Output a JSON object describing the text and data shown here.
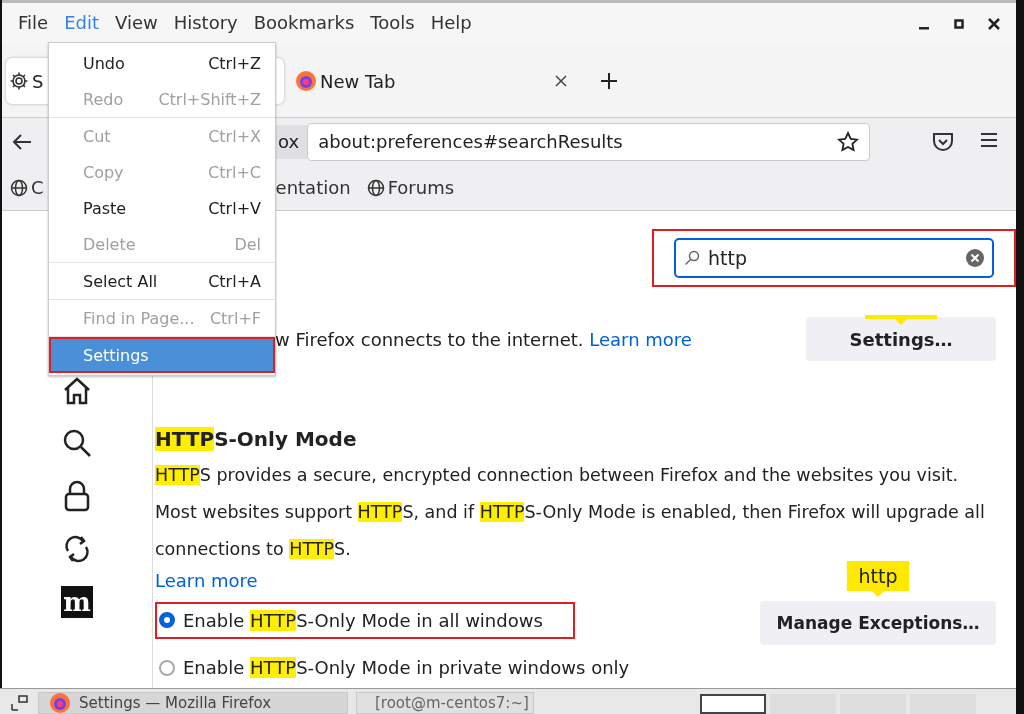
{
  "menu_bar": {
    "items": [
      {
        "label": "File",
        "selected": false
      },
      {
        "label": "Edit",
        "selected": true
      },
      {
        "label": "View",
        "selected": false
      },
      {
        "label": "History",
        "selected": false
      },
      {
        "label": "Bookmarks",
        "selected": false
      },
      {
        "label": "Tools",
        "selected": false
      },
      {
        "label": "Help",
        "selected": false
      }
    ],
    "window_controls": [
      {
        "kind": "minimize"
      },
      {
        "kind": "maximize"
      },
      {
        "kind": "close"
      }
    ]
  },
  "tabs": [
    {
      "kind": "settings",
      "label": "S",
      "selected": true
    },
    {
      "kind": "firefox",
      "label": "New Tab",
      "selected": false
    }
  ],
  "nav": {
    "identity": "ox",
    "url": "about:preferences#searchResults"
  },
  "bookmarks": [
    {
      "label": "C",
      "icon": true
    },
    {
      "label": "entation",
      "icon": false
    },
    {
      "label": "Forums",
      "icon": true
    }
  ],
  "edit_menu": {
    "items": [
      {
        "kind": "item",
        "label": "Undo",
        "shortcut": "Ctrl+Z",
        "disabled": false,
        "selected": false,
        "outlined": false
      },
      {
        "kind": "item",
        "label": "Redo",
        "shortcut": "Ctrl+Shift+Z",
        "disabled": true,
        "selected": false,
        "outlined": false
      },
      {
        "kind": "separator"
      },
      {
        "kind": "item",
        "label": "Cut",
        "shortcut": "Ctrl+X",
        "disabled": true,
        "selected": false,
        "outlined": false
      },
      {
        "kind": "item",
        "label": "Copy",
        "shortcut": "Ctrl+C",
        "disabled": true,
        "selected": false,
        "outlined": false
      },
      {
        "kind": "item",
        "label": "Paste",
        "shortcut": "Ctrl+V",
        "disabled": false,
        "selected": false,
        "outlined": false
      },
      {
        "kind": "item",
        "label": "Delete",
        "shortcut": "Del",
        "disabled": true,
        "selected": false,
        "outlined": false
      },
      {
        "kind": "separator"
      },
      {
        "kind": "item",
        "label": "Select All",
        "shortcut": "Ctrl+A",
        "disabled": false,
        "selected": false,
        "outlined": false
      },
      {
        "kind": "separator"
      },
      {
        "kind": "item",
        "label": "Find in Page...",
        "shortcut": "Ctrl+F",
        "disabled": true,
        "selected": false,
        "outlined": false
      },
      {
        "kind": "separator"
      },
      {
        "kind": "item",
        "label": "Settings",
        "disabled": false,
        "selected": true,
        "outlined": true
      }
    ]
  },
  "sidebar": {
    "items": [
      {
        "kind": "home"
      },
      {
        "kind": "search"
      },
      {
        "kind": "lock"
      },
      {
        "kind": "sync"
      },
      {
        "kind": "logo",
        "text": "m"
      }
    ]
  },
  "search": {
    "value": "http",
    "outlined": true
  },
  "connection": {
    "text": "w Firefox connects to the internet.",
    "link": "Learn more",
    "button": {
      "label": "Settings…",
      "match_marker": true
    }
  },
  "https_only": {
    "title": [
      {
        "text": "HTTP",
        "match": true
      },
      {
        "text": "S-Only Mode",
        "match": false
      }
    ],
    "paragraph": [
      {
        "text": "HTTP",
        "match": true
      },
      {
        "text": "S provides a secure, encrypted connection between Firefox and the websites you visit. Most websites support ",
        "match": false
      },
      {
        "text": "HTTP",
        "match": true
      },
      {
        "text": "S, and if ",
        "match": false
      },
      {
        "text": "HTTP",
        "match": true
      },
      {
        "text": "S-Only Mode is enabled, then Firefox will upgrade all connections to ",
        "match": false
      },
      {
        "text": "HTTP",
        "match": true
      },
      {
        "text": "S.",
        "match": false
      }
    ],
    "link": "Learn more",
    "options": [
      {
        "label": [
          {
            "text": "Enable ",
            "match": false
          },
          {
            "text": "HTTP",
            "match": true
          },
          {
            "text": "S-Only Mode in all windows",
            "match": false
          }
        ],
        "selected": true,
        "outlined": true
      },
      {
        "label": [
          {
            "text": "Enable ",
            "match": false
          },
          {
            "text": "HTTP",
            "match": true
          },
          {
            "text": "S-Only Mode in private windows only",
            "match": false
          }
        ],
        "selected": false,
        "outlined": false
      }
    ],
    "exceptions_button": {
      "label": "Manage Exceptions…",
      "tooltip": "http"
    }
  },
  "taskbar": {
    "windows": [
      {
        "kind": "firefox",
        "label": "Settings — Mozilla Firefox",
        "selected": true
      },
      {
        "kind": "terminal",
        "label": "[root@m-centos7:~]",
        "selected": false
      }
    ],
    "workspaces": [
      {
        "selected": true
      },
      {
        "selected": false
      },
      {
        "selected": false
      },
      {
        "selected": false
      }
    ]
  }
}
